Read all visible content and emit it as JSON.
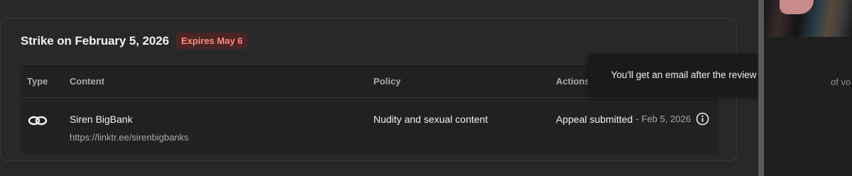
{
  "strike": {
    "title": "Strike on February 5, 2026",
    "expires_badge": "Expires May 6"
  },
  "table": {
    "headers": {
      "type": "Type",
      "content": "Content",
      "policy": "Policy",
      "actions": "Actions"
    },
    "row": {
      "type_icon": "link-icon",
      "content_title": "Siren BigBank",
      "content_url": "https://linktr.ee/sirenbigbanks",
      "policy": "Nudity and sexual content",
      "action_status": "Appeal submitted",
      "action_separator": "-",
      "action_date": "Feb 5, 2026",
      "action_icon": "info-icon"
    }
  },
  "tooltip": {
    "text": "You'll get an email after the review is complete"
  },
  "right_panel": {
    "partial_text": "of vo"
  },
  "colors": {
    "background": "#282828",
    "table_background": "#212121",
    "badge_background": "#4a2525",
    "badge_text": "#ff8a80",
    "muted_text": "#aaaaaa",
    "tooltip_background": "#1a1a1a"
  }
}
